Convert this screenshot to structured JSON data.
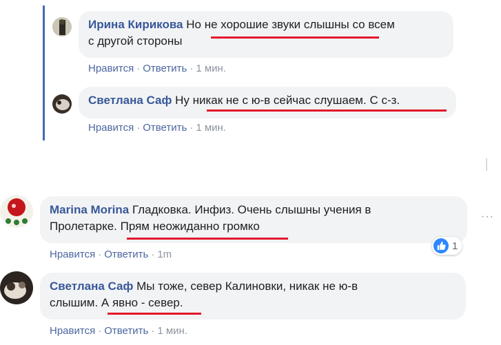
{
  "comments": [
    {
      "author": "Ирина Кирикова",
      "line1": "Но не хорошие звуки слышны со всем",
      "line2": "с другой стороны",
      "like": "Нравится",
      "reply": "Ответить",
      "time": "1 мин."
    },
    {
      "author": "Светлана Саф",
      "line1": "Ну никак не с ю-в сейчас слушаем. С с-з.",
      "like": "Нравится",
      "reply": "Ответить",
      "time": "1 мин."
    },
    {
      "author": "Marina Morina",
      "line1": "Гладковка. Инфиз. Очень слышны учения в",
      "line2": "Пролетарке. Прям неожиданно громко",
      "like": "Нравится",
      "reply": "Ответить",
      "time": "1m",
      "reactions": "1"
    },
    {
      "author": "Светлана Саф",
      "line1": "Мы тоже, север Калиновки, никак не ю-в",
      "line2": "слышим. А явно - север.",
      "like": "Нравится",
      "reply": "Ответить",
      "time": "1 мин."
    }
  ],
  "separator": "·",
  "menu_dots": "···",
  "colors": {
    "author": "#385898",
    "bubble": "#f2f3f5",
    "highlight": "#e3162b",
    "thread": "#4267b2"
  }
}
